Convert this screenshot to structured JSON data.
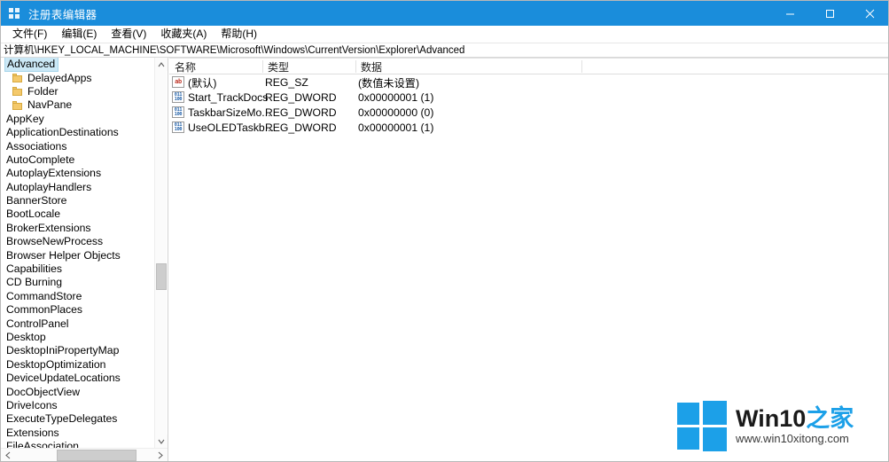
{
  "window": {
    "title": "注册表编辑器",
    "icon": "registry-editor-icon",
    "controls": {
      "minimize": "最小化",
      "maximize": "最大化",
      "close": "关闭"
    }
  },
  "menubar": {
    "items": [
      {
        "label": "文件(F)",
        "name": "menu-file"
      },
      {
        "label": "编辑(E)",
        "name": "menu-edit"
      },
      {
        "label": "查看(V)",
        "name": "menu-view"
      },
      {
        "label": "收藏夹(A)",
        "name": "menu-favorites"
      },
      {
        "label": "帮助(H)",
        "name": "menu-help"
      }
    ]
  },
  "address": {
    "path": "计算机\\HKEY_LOCAL_MACHINE\\SOFTWARE\\Microsoft\\Windows\\CurrentVersion\\Explorer\\Advanced"
  },
  "tree": {
    "selected": "Advanced",
    "items": [
      {
        "label": "Advanced",
        "indent": 0,
        "icon": "none",
        "selected": true
      },
      {
        "label": "DelayedApps",
        "indent": 1,
        "icon": "folder-icon",
        "selected": false
      },
      {
        "label": "Folder",
        "indent": 1,
        "icon": "folder-icon",
        "selected": false
      },
      {
        "label": "NavPane",
        "indent": 1,
        "icon": "folder-icon",
        "selected": false
      },
      {
        "label": "AppKey",
        "indent": 0,
        "icon": "none",
        "selected": false
      },
      {
        "label": "ApplicationDestinations",
        "indent": 0,
        "icon": "none",
        "selected": false
      },
      {
        "label": "Associations",
        "indent": 0,
        "icon": "none",
        "selected": false
      },
      {
        "label": "AutoComplete",
        "indent": 0,
        "icon": "none",
        "selected": false
      },
      {
        "label": "AutoplayExtensions",
        "indent": 0,
        "icon": "none",
        "selected": false
      },
      {
        "label": "AutoplayHandlers",
        "indent": 0,
        "icon": "none",
        "selected": false
      },
      {
        "label": "BannerStore",
        "indent": 0,
        "icon": "none",
        "selected": false
      },
      {
        "label": "BootLocale",
        "indent": 0,
        "icon": "none",
        "selected": false
      },
      {
        "label": "BrokerExtensions",
        "indent": 0,
        "icon": "none",
        "selected": false
      },
      {
        "label": "BrowseNewProcess",
        "indent": 0,
        "icon": "none",
        "selected": false
      },
      {
        "label": "Browser Helper Objects",
        "indent": 0,
        "icon": "none",
        "selected": false
      },
      {
        "label": "Capabilities",
        "indent": 0,
        "icon": "none",
        "selected": false
      },
      {
        "label": "CD Burning",
        "indent": 0,
        "icon": "none",
        "selected": false
      },
      {
        "label": "CommandStore",
        "indent": 0,
        "icon": "none",
        "selected": false
      },
      {
        "label": "CommonPlaces",
        "indent": 0,
        "icon": "none",
        "selected": false
      },
      {
        "label": "ControlPanel",
        "indent": 0,
        "icon": "none",
        "selected": false
      },
      {
        "label": "Desktop",
        "indent": 0,
        "icon": "none",
        "selected": false
      },
      {
        "label": "DesktopIniPropertyMap",
        "indent": 0,
        "icon": "none",
        "selected": false
      },
      {
        "label": "DesktopOptimization",
        "indent": 0,
        "icon": "none",
        "selected": false
      },
      {
        "label": "DeviceUpdateLocations",
        "indent": 0,
        "icon": "none",
        "selected": false
      },
      {
        "label": "DocObjectView",
        "indent": 0,
        "icon": "none",
        "selected": false
      },
      {
        "label": "DriveIcons",
        "indent": 0,
        "icon": "none",
        "selected": false
      },
      {
        "label": "ExecuteTypeDelegates",
        "indent": 0,
        "icon": "none",
        "selected": false
      },
      {
        "label": "Extensions",
        "indent": 0,
        "icon": "none",
        "selected": false
      },
      {
        "label": "FileAssociation",
        "indent": 0,
        "icon": "none",
        "selected": false
      }
    ],
    "scrollbar": {
      "up_arrow": "▲",
      "down_arrow": "▼",
      "left_arrow": "‹",
      "right_arrow": "›"
    }
  },
  "list": {
    "columns": [
      {
        "label": "名称",
        "name": "column-name"
      },
      {
        "label": "类型",
        "name": "column-type"
      },
      {
        "label": "数据",
        "name": "column-data"
      }
    ],
    "rows": [
      {
        "name": "(默认)",
        "type": "REG_SZ",
        "data": "(数值未设置)",
        "icon": "reg-sz-icon"
      },
      {
        "name": "Start_TrackDocs",
        "type": "REG_DWORD",
        "data": "0x00000001 (1)",
        "icon": "reg-dword-icon"
      },
      {
        "name": "TaskbarSizeMo...",
        "type": "REG_DWORD",
        "data": "0x00000000 (0)",
        "icon": "reg-dword-icon"
      },
      {
        "name": "UseOLEDTaskb...",
        "type": "REG_DWORD",
        "data": "0x00000001 (1)",
        "icon": "reg-dword-icon"
      }
    ]
  },
  "watermark": {
    "brand_main": "Win10",
    "brand_cn": "之家",
    "url": "www.win10xitong.com"
  },
  "colors": {
    "titlebar": "#1a8ddb",
    "accent": "#1ca0e8",
    "selection": "#cbe8f6",
    "folder": "#f4c96b"
  }
}
